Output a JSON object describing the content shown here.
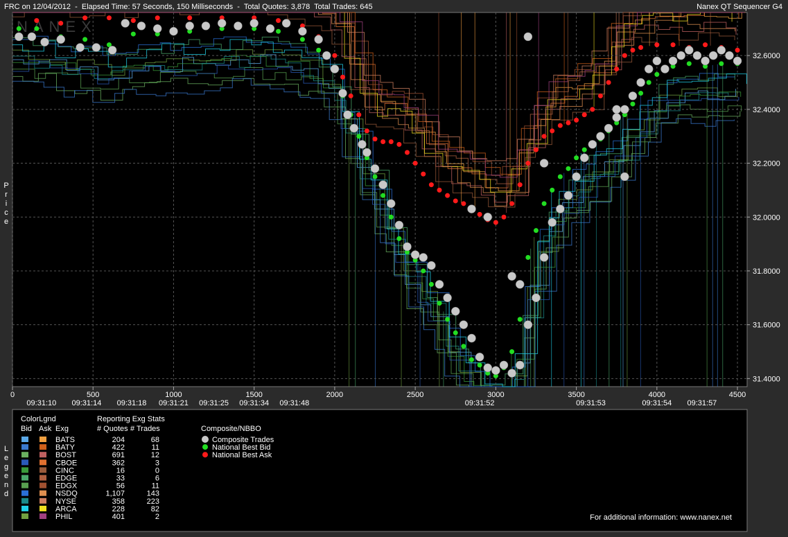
{
  "header": {
    "left": "FRC on 12/04/2012  -  Elapsed Time: 57 Seconds, 150 Milliseconds  -  Total Quotes: 3,878  Total Trades: 645",
    "right": "Nanex QT Sequencer G4"
  },
  "watermark": "NANEX",
  "side_labels": {
    "price": "Price",
    "legend": "Legend"
  },
  "colors": {
    "bid_line": "#3a82d6",
    "ask_line": "#d98a2a",
    "trade": "#c8c8c8",
    "best_bid": "#22dd22",
    "best_ask": "#ff1a1a",
    "grid": "#555555"
  },
  "chart_data": {
    "type": "scatter",
    "title": "",
    "xlabel": "",
    "ylabel": "Price",
    "xlim": [
      0,
      4560
    ],
    "ylim": [
      31.37,
      32.76
    ],
    "x_ticks": [
      0,
      500,
      1000,
      1500,
      2000,
      2500,
      3000,
      3500,
      4000,
      4500
    ],
    "y_ticks": [
      31.4,
      31.6,
      31.8,
      32.0,
      32.2,
      32.4,
      32.6
    ],
    "y_tick_labels": [
      "31.4000",
      "31.6000",
      "31.8000",
      "32.0000",
      "32.2000",
      "32.4000",
      "32.6000"
    ],
    "time_labels": [
      {
        "x": 180,
        "label": "09:31:10"
      },
      {
        "x": 460,
        "label": "09:31:14"
      },
      {
        "x": 740,
        "label": "09:31:18"
      },
      {
        "x": 1000,
        "label": "09:31:21"
      },
      {
        "x": 1250,
        "label": "09:31:25"
      },
      {
        "x": 1500,
        "label": "09:31:34"
      },
      {
        "x": 1750,
        "label": "09:31:48"
      },
      {
        "x": 2900,
        "label": "09:31:52"
      },
      {
        "x": 3590,
        "label": "09:31:53"
      },
      {
        "x": 4000,
        "label": "09:31:54"
      },
      {
        "x": 4280,
        "label": "09:31:57"
      }
    ],
    "grid": true,
    "series": [
      {
        "name": "Composite Trades",
        "points": [
          [
            40,
            32.67
          ],
          [
            120,
            32.67
          ],
          [
            200,
            32.65
          ],
          [
            300,
            32.66
          ],
          [
            420,
            32.63
          ],
          [
            520,
            32.63
          ],
          [
            620,
            32.62
          ],
          [
            700,
            32.72
          ],
          [
            800,
            32.71
          ],
          [
            900,
            32.7
          ],
          [
            1000,
            32.69
          ],
          [
            1100,
            32.71
          ],
          [
            1200,
            32.71
          ],
          [
            1300,
            32.72
          ],
          [
            1400,
            32.71
          ],
          [
            1500,
            32.72
          ],
          [
            1600,
            32.7
          ],
          [
            1700,
            32.72
          ],
          [
            1800,
            32.69
          ],
          [
            1900,
            32.66
          ],
          [
            1950,
            32.6
          ],
          [
            2000,
            32.55
          ],
          [
            2050,
            32.46
          ],
          [
            2080,
            32.38
          ],
          [
            2120,
            32.33
          ],
          [
            2170,
            32.27
          ],
          [
            2200,
            32.24
          ],
          [
            2250,
            32.18
          ],
          [
            2300,
            32.12
          ],
          [
            2350,
            32.05
          ],
          [
            2400,
            31.97
          ],
          [
            2450,
            31.89
          ],
          [
            2500,
            31.86
          ],
          [
            2550,
            31.85
          ],
          [
            2600,
            31.82
          ],
          [
            2650,
            31.75
          ],
          [
            2700,
            31.7
          ],
          [
            2750,
            31.65
          ],
          [
            2800,
            31.6
          ],
          [
            2850,
            31.55
          ],
          [
            2900,
            31.48
          ],
          [
            2950,
            31.44
          ],
          [
            3000,
            31.43
          ],
          [
            3050,
            31.45
          ],
          [
            3100,
            31.42
          ],
          [
            3150,
            31.45
          ],
          [
            3200,
            31.6
          ],
          [
            3250,
            31.7
          ],
          [
            3300,
            31.85
          ],
          [
            3350,
            31.98
          ],
          [
            3400,
            32.03
          ],
          [
            3450,
            32.08
          ],
          [
            3500,
            32.15
          ],
          [
            3550,
            32.22
          ],
          [
            3600,
            32.27
          ],
          [
            3650,
            32.3
          ],
          [
            3700,
            32.33
          ],
          [
            3750,
            32.37
          ],
          [
            3800,
            32.4
          ],
          [
            3850,
            32.45
          ],
          [
            3900,
            32.5
          ],
          [
            3950,
            32.55
          ],
          [
            4000,
            32.58
          ],
          [
            4050,
            32.55
          ],
          [
            4100,
            32.58
          ],
          [
            4150,
            32.6
          ],
          [
            4200,
            32.62
          ],
          [
            4250,
            32.6
          ],
          [
            4300,
            32.58
          ],
          [
            4350,
            32.6
          ],
          [
            4400,
            32.62
          ],
          [
            4450,
            32.6
          ],
          [
            4500,
            32.58
          ],
          [
            3200,
            32.67
          ],
          [
            2850,
            32.03
          ],
          [
            2950,
            32.0
          ],
          [
            3100,
            31.78
          ],
          [
            3150,
            31.75
          ],
          [
            3300,
            32.2
          ],
          [
            3800,
            32.15
          ],
          [
            3750,
            32.4
          ]
        ]
      },
      {
        "name": "National Best Bid",
        "points": [
          [
            40,
            32.7
          ],
          [
            150,
            32.7
          ],
          [
            300,
            32.67
          ],
          [
            450,
            32.66
          ],
          [
            600,
            32.64
          ],
          [
            750,
            32.68
          ],
          [
            900,
            32.68
          ],
          [
            1100,
            32.69
          ],
          [
            1300,
            32.7
          ],
          [
            1500,
            32.7
          ],
          [
            1650,
            32.69
          ],
          [
            1800,
            32.66
          ],
          [
            1900,
            32.62
          ],
          [
            2000,
            32.55
          ],
          [
            2050,
            32.45
          ],
          [
            2100,
            32.38
          ],
          [
            2150,
            32.3
          ],
          [
            2200,
            32.22
          ],
          [
            2250,
            32.15
          ],
          [
            2300,
            32.08
          ],
          [
            2350,
            32.0
          ],
          [
            2400,
            31.92
          ],
          [
            2450,
            31.87
          ],
          [
            2500,
            31.84
          ],
          [
            2550,
            31.8
          ],
          [
            2600,
            31.75
          ],
          [
            2650,
            31.68
          ],
          [
            2700,
            31.62
          ],
          [
            2750,
            31.57
          ],
          [
            2800,
            31.52
          ],
          [
            2850,
            31.47
          ],
          [
            2900,
            31.45
          ],
          [
            2950,
            31.42
          ],
          [
            3000,
            31.41
          ],
          [
            3050,
            31.44
          ],
          [
            3100,
            31.5
          ],
          [
            3150,
            31.62
          ],
          [
            3200,
            31.85
          ],
          [
            3250,
            31.95
          ],
          [
            3300,
            32.05
          ],
          [
            3350,
            32.1
          ],
          [
            3400,
            32.15
          ],
          [
            3450,
            32.18
          ],
          [
            3500,
            32.22
          ],
          [
            3550,
            32.25
          ],
          [
            3600,
            32.27
          ],
          [
            3650,
            32.29
          ],
          [
            3700,
            32.32
          ],
          [
            3750,
            32.35
          ],
          [
            3800,
            32.38
          ],
          [
            3850,
            32.42
          ],
          [
            3900,
            32.46
          ],
          [
            3950,
            32.5
          ],
          [
            4000,
            32.53
          ],
          [
            4100,
            32.56
          ],
          [
            4200,
            32.57
          ],
          [
            4300,
            32.56
          ],
          [
            4400,
            32.57
          ],
          [
            4500,
            32.57
          ]
        ]
      },
      {
        "name": "National Best Ask",
        "points": [
          [
            150,
            32.73
          ],
          [
            300,
            32.72
          ],
          [
            450,
            32.74
          ],
          [
            600,
            32.74
          ],
          [
            750,
            32.73
          ],
          [
            900,
            32.74
          ],
          [
            1100,
            32.74
          ],
          [
            1300,
            32.74
          ],
          [
            1500,
            32.74
          ],
          [
            1650,
            32.73
          ],
          [
            1800,
            32.71
          ],
          [
            1900,
            32.67
          ],
          [
            2000,
            32.6
          ],
          [
            2050,
            32.52
          ],
          [
            2100,
            32.45
          ],
          [
            2150,
            32.38
          ],
          [
            2200,
            32.32
          ],
          [
            2250,
            32.29
          ],
          [
            2300,
            32.28
          ],
          [
            2350,
            32.28
          ],
          [
            2400,
            32.27
          ],
          [
            2450,
            32.24
          ],
          [
            2500,
            32.2
          ],
          [
            2550,
            32.16
          ],
          [
            2600,
            32.12
          ],
          [
            2650,
            32.1
          ],
          [
            2700,
            32.08
          ],
          [
            2750,
            32.06
          ],
          [
            2800,
            32.05
          ],
          [
            2850,
            32.03
          ],
          [
            2900,
            32.01
          ],
          [
            2950,
            31.99
          ],
          [
            3000,
            31.98
          ],
          [
            3050,
            32.0
          ],
          [
            3100,
            32.05
          ],
          [
            3150,
            32.12
          ],
          [
            3200,
            32.2
          ],
          [
            3250,
            32.25
          ],
          [
            3300,
            32.3
          ],
          [
            3350,
            32.32
          ],
          [
            3400,
            32.34
          ],
          [
            3450,
            32.35
          ],
          [
            3500,
            32.36
          ],
          [
            3550,
            32.38
          ],
          [
            3600,
            32.4
          ],
          [
            3650,
            32.45
          ],
          [
            3700,
            32.5
          ],
          [
            3750,
            32.55
          ],
          [
            3800,
            32.6
          ],
          [
            3850,
            32.62
          ],
          [
            3900,
            32.63
          ],
          [
            4000,
            32.64
          ],
          [
            4100,
            32.64
          ],
          [
            4200,
            32.63
          ],
          [
            4300,
            32.64
          ],
          [
            4400,
            32.63
          ],
          [
            4500,
            32.62
          ]
        ]
      }
    ]
  },
  "legend": {
    "colorlegend_title": "ColorLgnd",
    "bid_header": "Bid",
    "ask_header": "Ask",
    "exg_header": "Exg",
    "stats_title": "Reporting Exg Stats",
    "quotes_header": "# Quotes",
    "trades_header": "# Trades",
    "composite_title": "Composite/NBBO",
    "composite_items": [
      "Composite Trades",
      "National Best Bid",
      "National Best Ask"
    ],
    "footer": "For additional information: www.nanex.net",
    "rows": [
      {
        "exg": "BATS",
        "quotes": "204",
        "trades": "68",
        "bid_color": "#5aa8e8",
        "ask_color": "#f0a040"
      },
      {
        "exg": "BATY",
        "quotes": "422",
        "trades": "11",
        "bid_color": "#3a7ad0",
        "ask_color": "#d0601a"
      },
      {
        "exg": "BOST",
        "quotes": "691",
        "trades": "12",
        "bid_color": "#6ab060",
        "ask_color": "#c06060"
      },
      {
        "exg": "CBOE",
        "quotes": "362",
        "trades": "3",
        "bid_color": "#2a5ab8",
        "ask_color": "#e07030"
      },
      {
        "exg": "CINC",
        "quotes": "16",
        "trades": "0",
        "bid_color": "#3a9a3a",
        "ask_color": "#9a5a3a"
      },
      {
        "exg": "EDGE",
        "quotes": "33",
        "trades": "6",
        "bid_color": "#4aa86a",
        "ask_color": "#b06040"
      },
      {
        "exg": "EDGX",
        "quotes": "56",
        "trades": "11",
        "bid_color": "#58a050",
        "ask_color": "#a05030"
      },
      {
        "exg": "NSDQ",
        "quotes": "1,107",
        "trades": "143",
        "bid_color": "#2a70d8",
        "ask_color": "#e09050"
      },
      {
        "exg": "NYSE",
        "quotes": "358",
        "trades": "223",
        "bid_color": "#1a8a8a",
        "ask_color": "#d08060"
      },
      {
        "exg": "ARCA",
        "quotes": "228",
        "trades": "82",
        "bid_color": "#20d0e8",
        "ask_color": "#f0e020"
      },
      {
        "exg": "PHIL",
        "quotes": "401",
        "trades": "2",
        "bid_color": "#70a040",
        "ask_color": "#a04080"
      }
    ]
  }
}
